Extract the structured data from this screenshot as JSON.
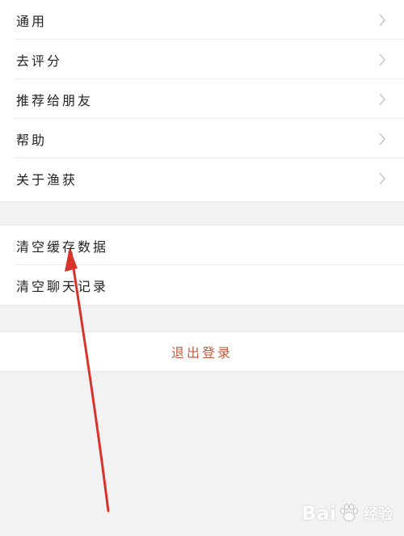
{
  "settings": {
    "group1": [
      {
        "label": "通用"
      },
      {
        "label": "去评分"
      },
      {
        "label": "推荐给朋友"
      },
      {
        "label": "帮助"
      },
      {
        "label": "关于渔获"
      }
    ],
    "group2": [
      {
        "label": "清空缓存数据"
      },
      {
        "label": "清空聊天记录"
      }
    ],
    "logout_label": "退出登录"
  },
  "watermark": {
    "brand": "Bai",
    "brand_suffix": "经验"
  },
  "colors": {
    "logout_text": "#c85a3e",
    "annotation_arrow": "#d8332b",
    "background": "#f2f2f2",
    "row_background": "#ffffff"
  },
  "icons": {
    "row_chevron": "chevron-right-icon",
    "watermark_logo": "paw-icon"
  }
}
